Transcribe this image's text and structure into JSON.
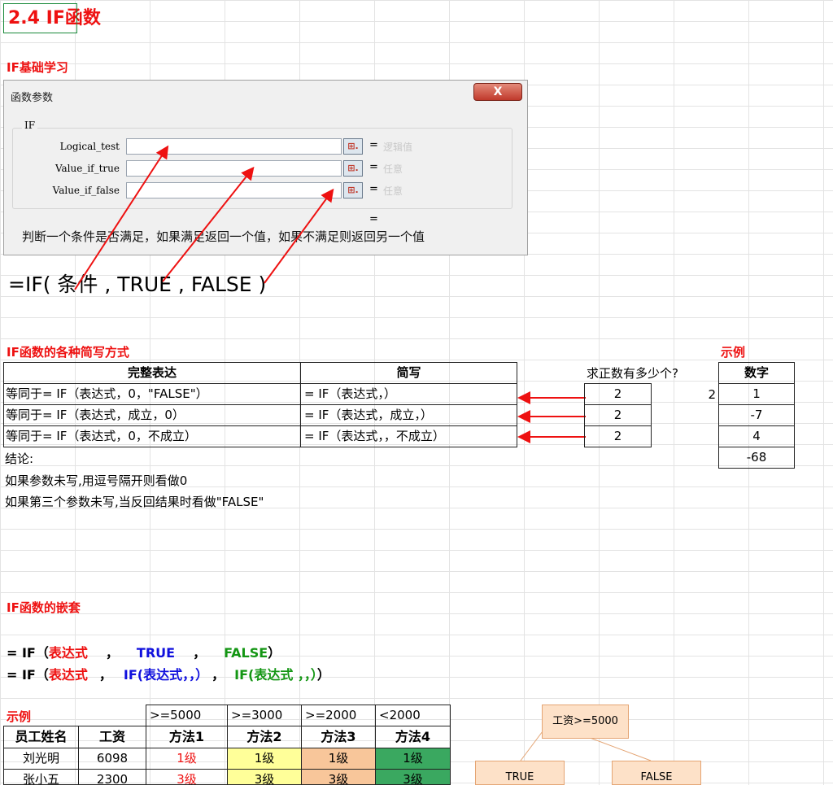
{
  "title": "2.4 IF函数",
  "section_basic": "IF基础学习",
  "dialog": {
    "title": "函数参数",
    "close_label": "X",
    "func_name": "IF",
    "args": [
      {
        "name": "Logical_test",
        "hint": "逻辑值"
      },
      {
        "name": "Value_if_true",
        "hint": "任意"
      },
      {
        "name": "Value_if_false",
        "hint": "任意"
      }
    ],
    "ref_button": "⊞.",
    "equals": "=",
    "result_equals": "=",
    "description": "判断一个条件是否满足，如果满足返回一个值，如果不满足则返回另一个值"
  },
  "formula_big": "=IF( 条件 , TRUE , FALSE )",
  "section_shorthand": "IF函数的各种简写方式",
  "shorthand_table": {
    "headers": [
      "完整表达",
      "简写"
    ],
    "rows": [
      [
        "等同于= IF（表达式，0，\"FALSE\"）",
        "= IF（表达式，）"
      ],
      [
        "等同于= IF（表达式，成立，0）",
        "= IF（表达式，成立，）"
      ],
      [
        "等同于= IF（表达式，0，不成立）",
        "= IF（表达式，，不成立）"
      ]
    ]
  },
  "question": "求正数有多少个?",
  "answers": [
    "2",
    "2",
    "2"
  ],
  "side_value": "2",
  "example_label": "示例",
  "number_table": {
    "header": "数字",
    "values": [
      "1",
      "-7",
      "4",
      "-68"
    ]
  },
  "conclusion": {
    "title": "结论:",
    "lines": [
      "如果参数未写,用逗号隔开则看做0",
      "如果第三个参数未写,当反回结果时看做\"FALSE\""
    ]
  },
  "section_nested": "IF函数的嵌套",
  "nested": {
    "line1": {
      "prefix": "= IF（",
      "expr": "表达式",
      "sep1": "，",
      "t": "TRUE",
      "sep2": "，",
      "f": "FALSE",
      "suffix": "）"
    },
    "line2": {
      "prefix": "= IF（",
      "expr": "表达式",
      "sep1": "，",
      "inner1": "IF(表达式，，）",
      "sep2": "，",
      "inner2": "IF(表达式 ，，）",
      "suffix": "）"
    }
  },
  "example2_label": "示例",
  "salary_table": {
    "thresholds": [
      ">=5000",
      ">=3000",
      ">=2000",
      "<2000"
    ],
    "headers": [
      "员工姓名",
      "工资",
      "方法1",
      "方法2",
      "方法3",
      "方法4"
    ],
    "rows": [
      [
        "刘光明",
        "6098",
        "1级",
        "1级",
        "1级",
        "1级"
      ],
      [
        "张小五",
        "2300",
        "3级",
        "3级",
        "3级",
        "3级"
      ]
    ]
  },
  "tree": {
    "root": "工资>=5000",
    "left": "TRUE",
    "right": "FALSE"
  },
  "colors": {
    "heading_red": "#ee1111",
    "true_blue": "#1010dd",
    "false_green": "#149614",
    "arrow_red": "#ee1111"
  }
}
